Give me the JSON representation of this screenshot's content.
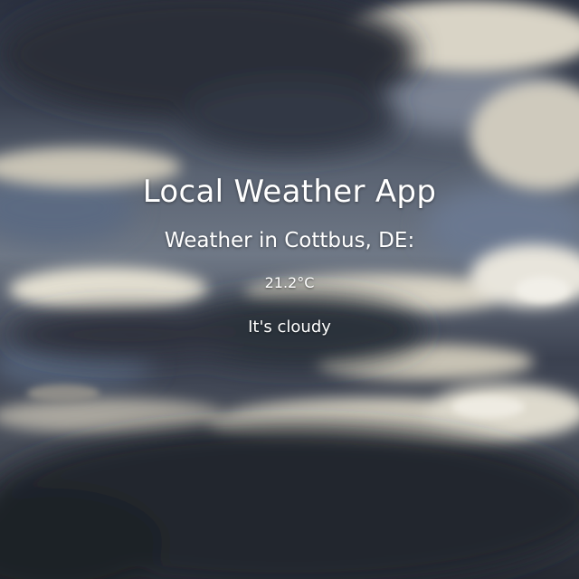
{
  "app": {
    "title": "Local Weather App"
  },
  "weather": {
    "location_prefix": "Weather in ",
    "location": "Cottbus, DE",
    "location_suffix": ":",
    "temperature_value": "21.2",
    "temperature_unit": "°C",
    "condition": "It's cloudy"
  },
  "background": {
    "icon": "cloudy-sky-photo",
    "sky_color": "#5b6a82",
    "cloud_highlight_color": "#e4e0d4",
    "cloud_shadow_color": "#2a2e38"
  }
}
